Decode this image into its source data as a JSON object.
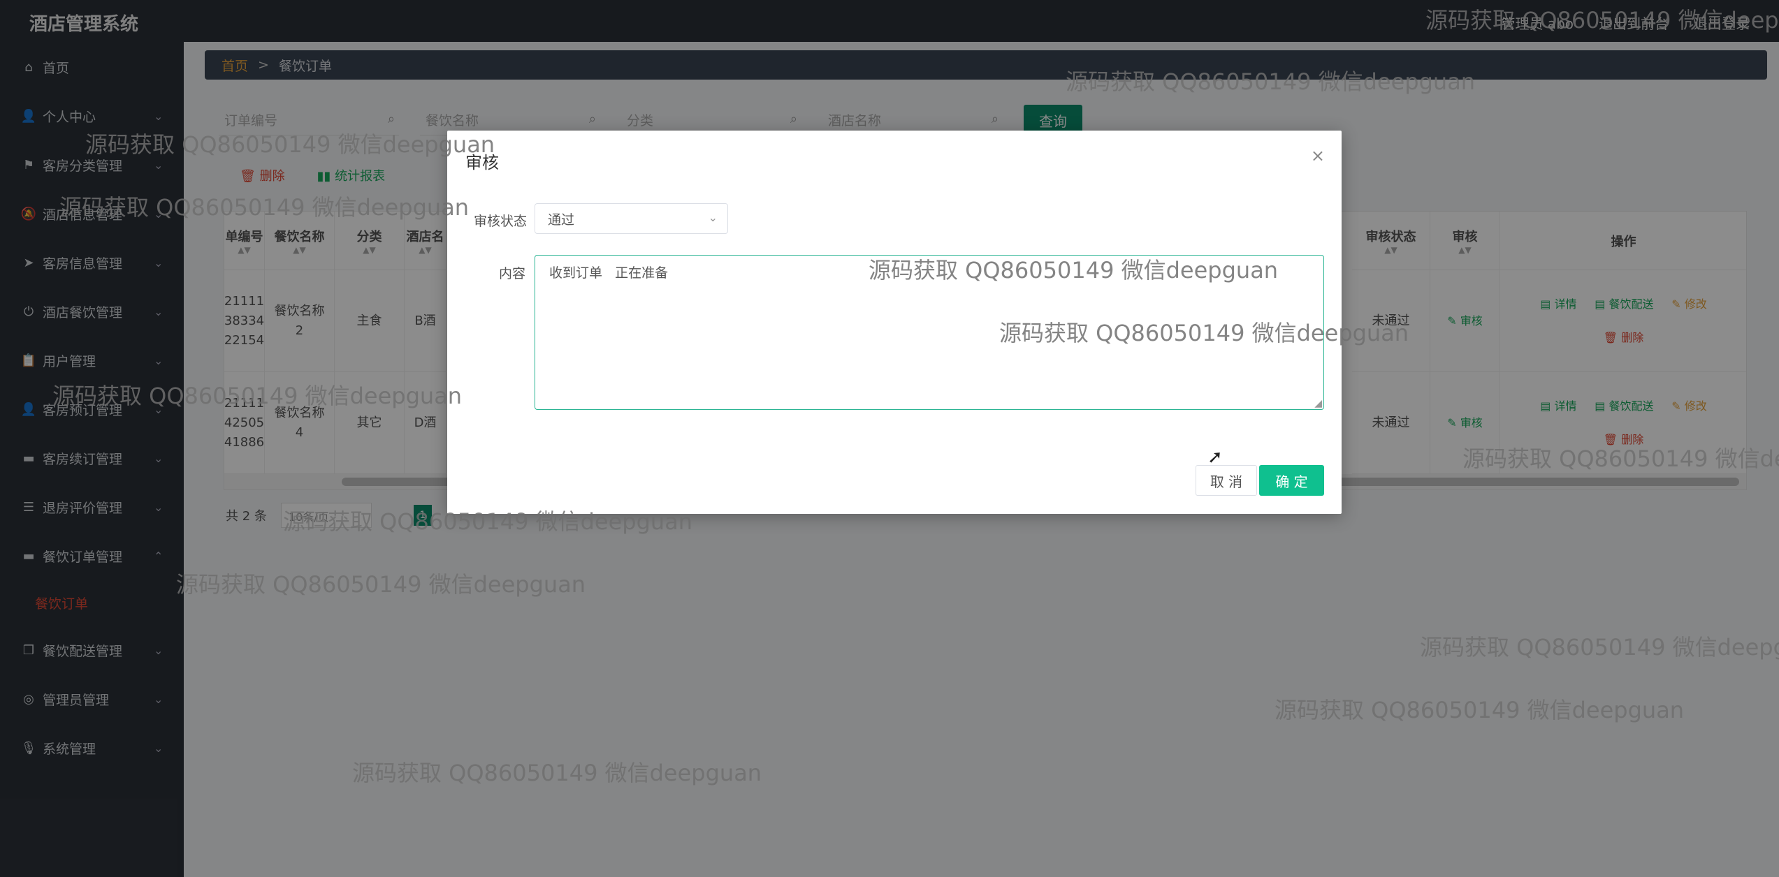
{
  "header": {
    "title": "酒店管理系统",
    "links": [
      "管理员 abo",
      "退出到前台",
      "退出登录"
    ]
  },
  "sidebar": {
    "items": [
      {
        "icon": "home-icon",
        "glyph": "⌂",
        "label": "首页",
        "arrow": ""
      },
      {
        "icon": "user-icon",
        "glyph": "👤",
        "label": "个人中心",
        "arrow": "⌄"
      },
      {
        "icon": "flag-icon",
        "glyph": "⚑",
        "label": "客房分类管理",
        "arrow": "⌄"
      },
      {
        "icon": "bell-off-icon",
        "glyph": "🔕",
        "label": "酒店信息管理",
        "arrow": "⌄"
      },
      {
        "icon": "send-icon",
        "glyph": "➤",
        "label": "客房信息管理",
        "arrow": "⌄"
      },
      {
        "icon": "power-icon",
        "glyph": "⏻",
        "label": "酒店餐饮管理",
        "arrow": "⌄"
      },
      {
        "icon": "clipboard-icon",
        "glyph": "📋",
        "label": "用户管理",
        "arrow": "⌄"
      },
      {
        "icon": "person-icon",
        "glyph": "👤",
        "label": "客房预订管理",
        "arrow": "⌄"
      },
      {
        "icon": "monitor-icon",
        "glyph": "▬",
        "label": "客房续订管理",
        "arrow": "⌄"
      },
      {
        "icon": "list-icon",
        "glyph": "☰",
        "label": "退房评价管理",
        "arrow": "⌄"
      },
      {
        "icon": "monitor-icon",
        "glyph": "▬",
        "label": "餐饮订单管理",
        "arrow": "⌃"
      },
      {
        "icon": "copy-icon",
        "glyph": "❐",
        "label": "餐饮配送管理",
        "arrow": "⌄"
      },
      {
        "icon": "settings-icon",
        "glyph": "◎",
        "label": "管理员管理",
        "arrow": "⌄"
      },
      {
        "icon": "mic-icon",
        "glyph": "🎙",
        "label": "系统管理",
        "arrow": "⌄"
      }
    ],
    "sub_item": "餐饮订单"
  },
  "breadcrumb": {
    "home": "首页",
    "sep": ">",
    "current": "餐饮订单"
  },
  "search": {
    "placeholders": [
      "订单编号",
      "餐饮名称",
      "分类",
      "酒店名称"
    ],
    "button": "查询"
  },
  "toolbar": {
    "delete": "删除",
    "stats": "统计报表"
  },
  "table": {
    "headers": [
      "单编号",
      "餐饮名称",
      "分类",
      "酒店名",
      "审核状态",
      "审核",
      "操作"
    ],
    "rows": [
      {
        "id": "21111\n38334\n22154",
        "name": "餐饮名称\n2",
        "category": "主食",
        "hotel": "B酒",
        "status": "未通过",
        "audit": "审核"
      },
      {
        "id": "21111\n42505\n41886",
        "name": "餐饮名称\n4",
        "category": "其它",
        "hotel": "D酒",
        "status": "未通过",
        "audit": "审核"
      }
    ],
    "ops": {
      "detail": "详情",
      "delivery": "餐饮配送",
      "edit": "修改",
      "delete": "删除"
    }
  },
  "pager": {
    "total": "共 2 条",
    "size": "10条/页",
    "page": "1"
  },
  "dialog": {
    "title": "审核",
    "status_label": "审核状态",
    "status_value": "通过",
    "content_label": "内容",
    "content_value": "收到订单   正在准备",
    "cancel": "取 消",
    "ok": "确 定"
  },
  "watermark": "源码获取 QQ86050149 微信deepguan",
  "colors": {
    "accent": "#0fc08f",
    "sidebar": "#2b3138",
    "danger": "#e04a36",
    "warning": "#e6a23c",
    "success": "#19a85b"
  }
}
